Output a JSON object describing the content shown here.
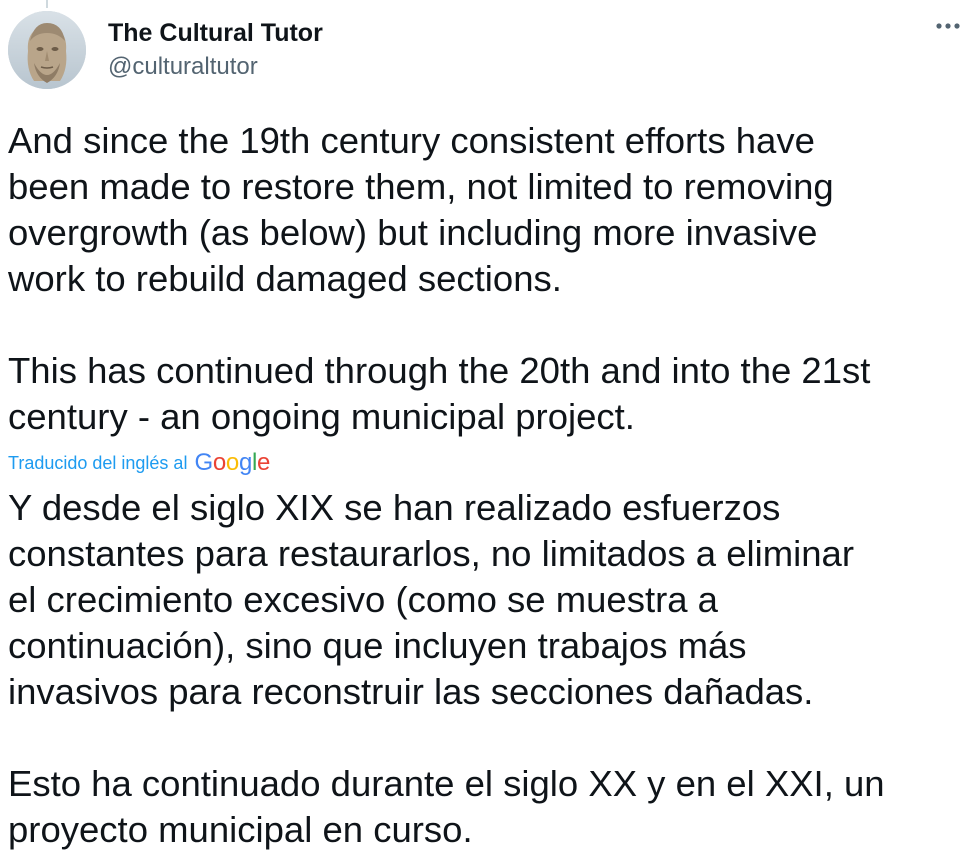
{
  "author": {
    "name": "The Cultural Tutor",
    "handle": "@culturaltutor",
    "avatar_icon": "classical-bust-avatar"
  },
  "more_icon": "more-horizontal-icon",
  "tweet": {
    "original_text": "And since the 19th century consistent efforts have\nbeen made to restore them, not limited to removing\novergrowth (as below) but including more invasive\nwork to rebuild damaged sections.\n\nThis has continued through the 20th and into the 21st\ncentury - an ongoing municipal project.",
    "translation_label": "Traducido del inglés al",
    "translation_provider": "Google",
    "translated_text": "Y desde el siglo XIX se han realizado esfuerzos\nconstantes para restaurarlos, no limitados a eliminar\nel crecimiento excesivo (como se muestra a\ncontinuación), sino que incluyen trabajos más\ninvasivos para reconstruir las secciones dañadas.\n\nEsto ha continuado durante el siglo XX y en el XXI, un\nproyecto municipal en curso."
  },
  "colors": {
    "text_primary": "#0f1419",
    "text_secondary": "#536471",
    "link_blue": "#1d9bf0",
    "google_blue": "#4285f4",
    "google_red": "#ea4335",
    "google_yellow": "#fbbc05",
    "google_green": "#34a853"
  }
}
